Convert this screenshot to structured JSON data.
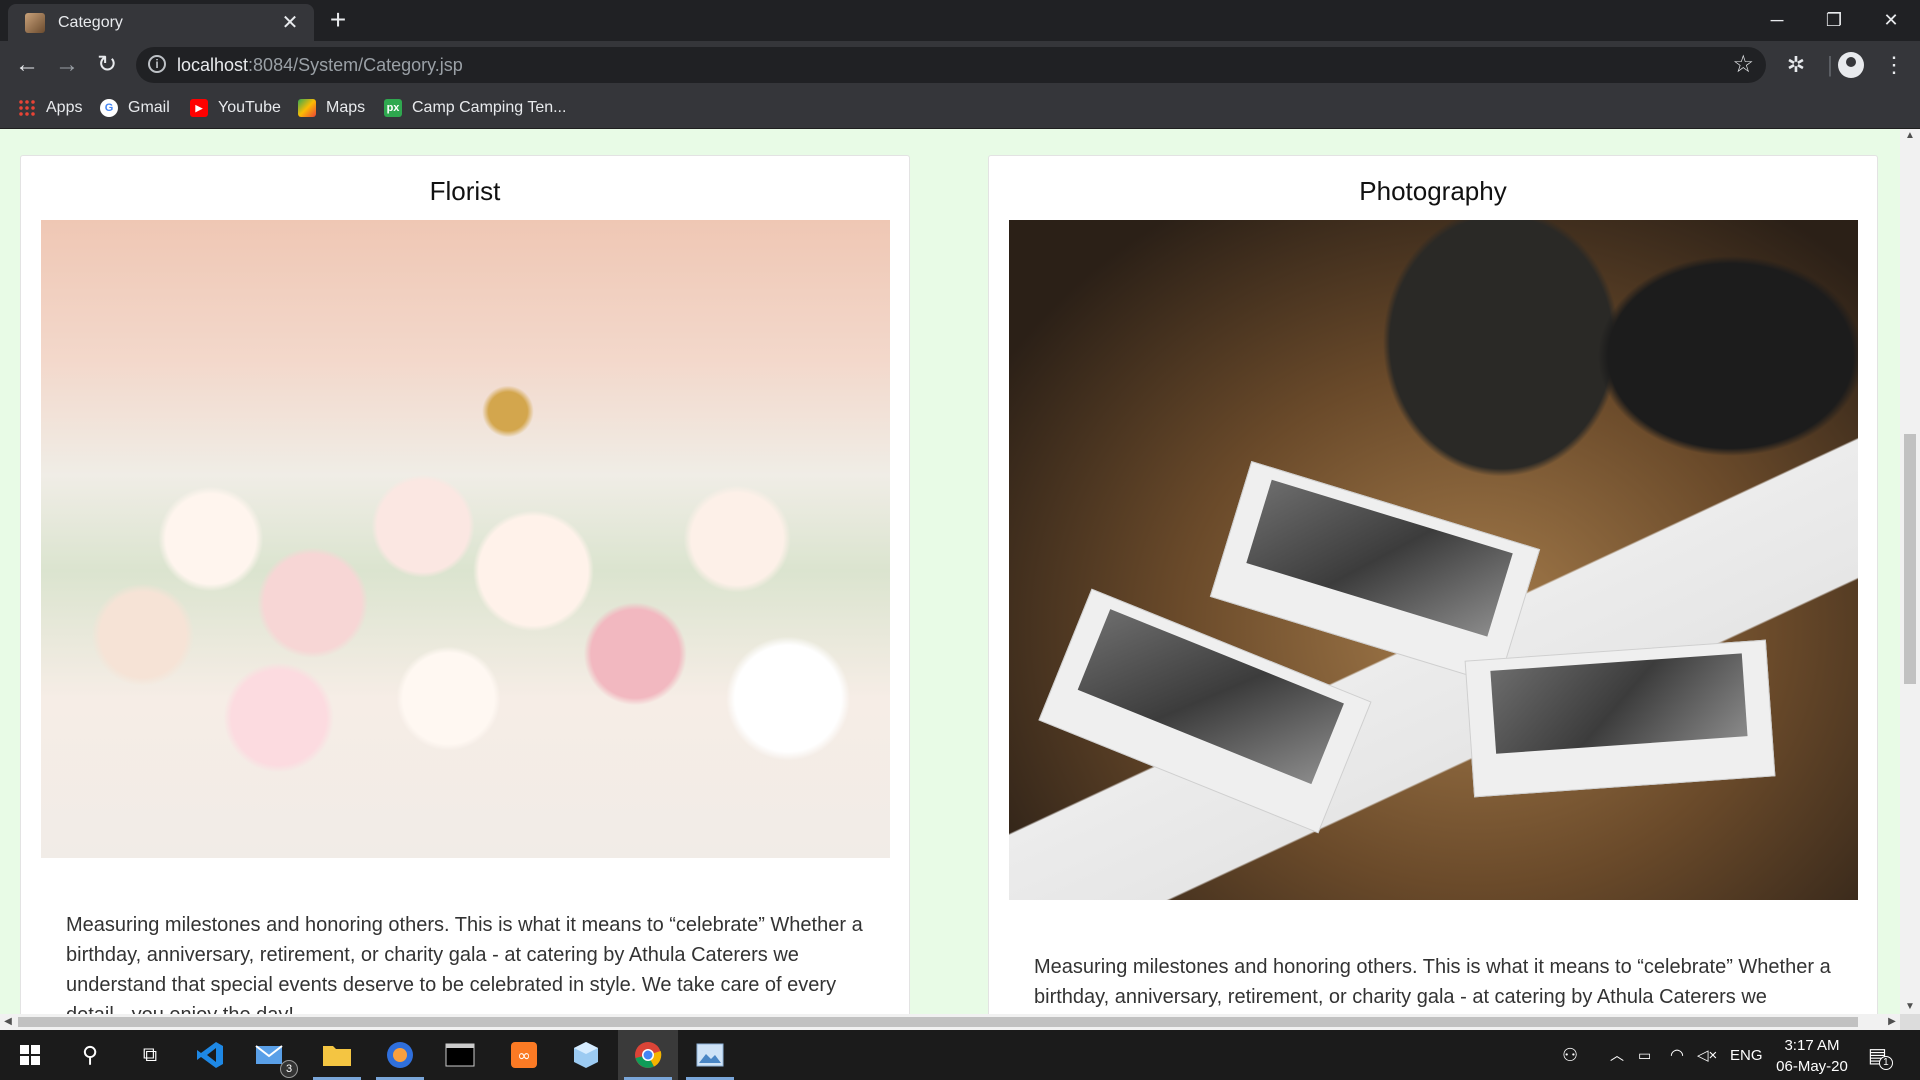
{
  "browser": {
    "tab_title": "Category",
    "url_host": "localhost",
    "url_rest": ":8084/System/Category.jsp",
    "bookmarks": [
      "Apps",
      "Gmail",
      "YouTube",
      "Maps",
      "Camp Camping Ten..."
    ]
  },
  "page": {
    "cards": [
      {
        "title": "Florist",
        "description": "Measuring milestones and honoring others. This is what it means to “celebrate” Whether a birthday, anniversary, retirement, or charity gala - at catering by Athula Caterers we understand that special events deserve to be celebrated in style. We take care of every detail - you enjoy the day!"
      },
      {
        "title": "Photography",
        "description": "Measuring milestones and honoring others. This is what it means to “celebrate” Whether a birthday, anniversary, retirement, or charity gala - at catering by Athula Caterers we understand that special events deserve to be celebrated in style. We take care of every detail - you enjoy the day!"
      }
    ],
    "background_color": "#e8fbe6"
  },
  "taskbar": {
    "mail_badge": "3",
    "language": "ENG",
    "time": "3:17 AM",
    "date": "06-May-20",
    "notification_count": "1"
  }
}
